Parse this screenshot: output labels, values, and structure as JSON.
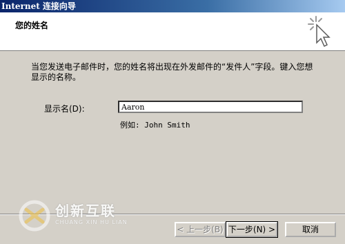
{
  "window": {
    "title": "Internet 连接向导"
  },
  "header": {
    "title": "您的姓名",
    "icon": "wizard-cursor-icon"
  },
  "main": {
    "intro": "当您发送电子邮件时，您的姓名将出现在外发邮件的“发件人”字段。键入您想显示的名称。",
    "display_name_label": "显示名(D):",
    "display_name_value": "Aaron",
    "example": "例如: John Smith"
  },
  "buttons": {
    "back": "< 上一步(B)",
    "next": "下一步(N) >",
    "cancel": "取消"
  },
  "watermark": {
    "name": "创新互联",
    "subtitle": "CHUANG XIN HU LIAN",
    "logo_icon": "chuangxin-logo-icon"
  },
  "colors": {
    "face": "#d4d0c8",
    "title_start": "#0a246a",
    "title_end": "#a6caf0",
    "header_bg": "#ffffff"
  }
}
